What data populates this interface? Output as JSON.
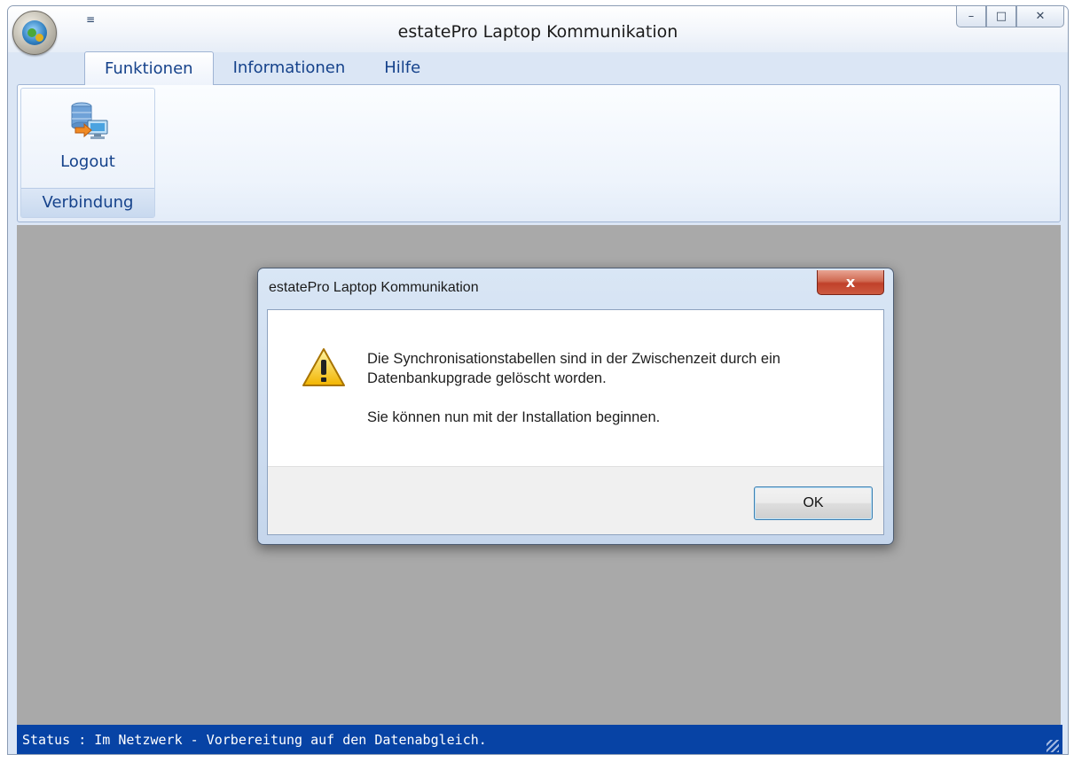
{
  "window": {
    "title": "estatePro Laptop Kommunikation",
    "qat_glyph": "≡",
    "min_glyph": "–",
    "max_glyph": "□",
    "close_glyph": "✕"
  },
  "ribbon": {
    "tabs": [
      {
        "label": "Funktionen",
        "active": true
      },
      {
        "label": "Informationen",
        "active": false
      },
      {
        "label": "Hilfe",
        "active": false
      }
    ],
    "groups": [
      {
        "label": "Verbindung",
        "buttons": [
          {
            "label": "Logout",
            "icon": "database-computer-icon"
          }
        ]
      }
    ]
  },
  "dialog": {
    "title": "estatePro Laptop Kommunikation",
    "close_glyph": "x",
    "icon": "warning-icon",
    "message_line1": "Die Synchronisationstabellen sind in der Zwischenzeit durch ein",
    "message_line2": "Datenbankupgrade gelöscht worden.",
    "message_line3": "Sie können nun mit der Installation beginnen.",
    "ok_label": "OK"
  },
  "status": {
    "text": "Status : Im Netzwerk - Vorbereitung auf den Datenabgleich."
  },
  "colors": {
    "status_bar": "#0743a5",
    "workspace": "#a9a9a9",
    "ribbon_text": "#15428b"
  }
}
